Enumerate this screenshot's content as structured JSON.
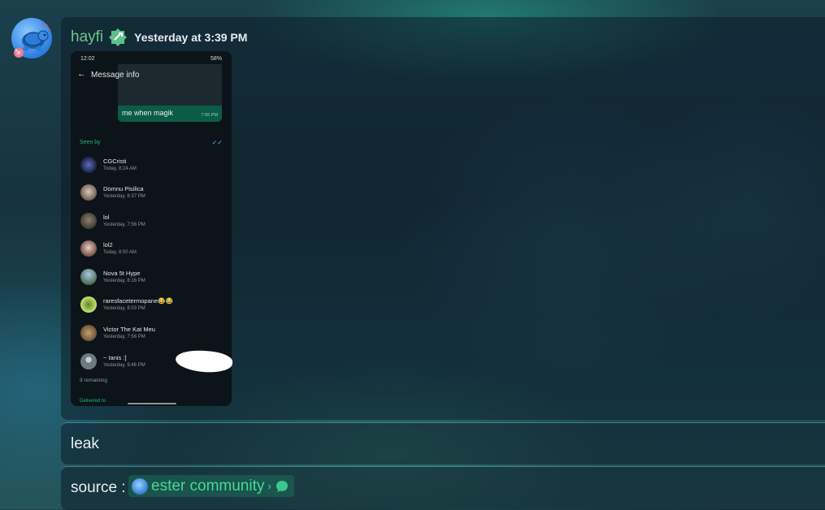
{
  "message": {
    "username": "hayfi",
    "timestamp": "Yesterday at 3:39 PM",
    "lines": [
      "leak",
      "source :"
    ]
  },
  "mention": {
    "server_name": "ester community",
    "icon": "chat-bubble-icon"
  },
  "screenshot": {
    "status_time": "12:02",
    "status_right": "58%",
    "header_title": "Message info",
    "bubble_text": "me when magik",
    "bubble_time": "7:55 PM",
    "seen_by_label": "Seen by",
    "contacts": [
      {
        "name": "CGCristi",
        "time": "Today, 8:24 AM"
      },
      {
        "name": "Domnu Pisilica",
        "time": "Yesterday, 8:37 PM"
      },
      {
        "name": "lol",
        "time": "Yesterday, 7:56 PM"
      },
      {
        "name": "lol2",
        "time": "Today, 8:00 AM"
      },
      {
        "name": "Nova 5t Hype",
        "time": "Yesterday, 8:16 PM"
      },
      {
        "name": "raresfacetermopane😂😂",
        "time": "Yesterday, 8:03 PM"
      },
      {
        "name": "Victor The Kat Meu",
        "time": "Yesterday, 7:56 PM"
      },
      {
        "name": "~ Ianis :]",
        "time": "Yesterday, 9:46 PM"
      }
    ],
    "remaining": "9 remaining",
    "delivered_label": "Delivered to"
  },
  "colors": {
    "username": "#71c58a",
    "mention_text": "#48d69a",
    "seen_green": "#25b574",
    "tick_blue": "#4fb4e8"
  }
}
